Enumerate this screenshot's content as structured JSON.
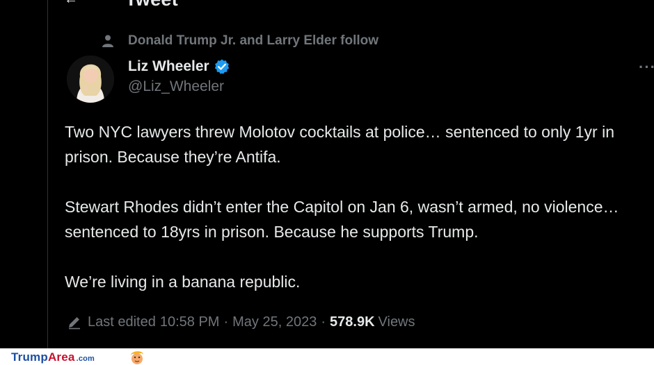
{
  "header": {
    "title": "Tweet"
  },
  "social_context": {
    "text": "Donald Trump Jr. and Larry Elder follow",
    "icon": "person-icon"
  },
  "author": {
    "name": "Liz Wheeler",
    "handle": "@Liz_Wheeler",
    "verified": true,
    "verified_color": "#1d9bf0"
  },
  "tweet": {
    "paragraphs": [
      "Two NYC lawyers threw Molotov cocktails at police… sentenced to only 1yr in prison. Because they’re Antifa.",
      "Stewart Rhodes didn’t enter the Capitol on Jan 6, wasn’t armed, no violence… sentenced to 18yrs in prison. Because he supports Trump.",
      "We’re living in a banana republic."
    ]
  },
  "meta": {
    "edited_label": "Last edited",
    "time": "10:58 PM",
    "separator": "·",
    "date": "May 25, 2023",
    "views_count": "578.9K",
    "views_label": "Views"
  },
  "watermark": {
    "brand_part1": "Trump",
    "brand_part2": "Area",
    "brand_suffix": ".com"
  },
  "colors": {
    "background": "#000000",
    "text_primary": "#e7e9ea",
    "text_secondary": "#71767b",
    "brand_blue": "#1d4fa3",
    "brand_red": "#c8102e"
  }
}
